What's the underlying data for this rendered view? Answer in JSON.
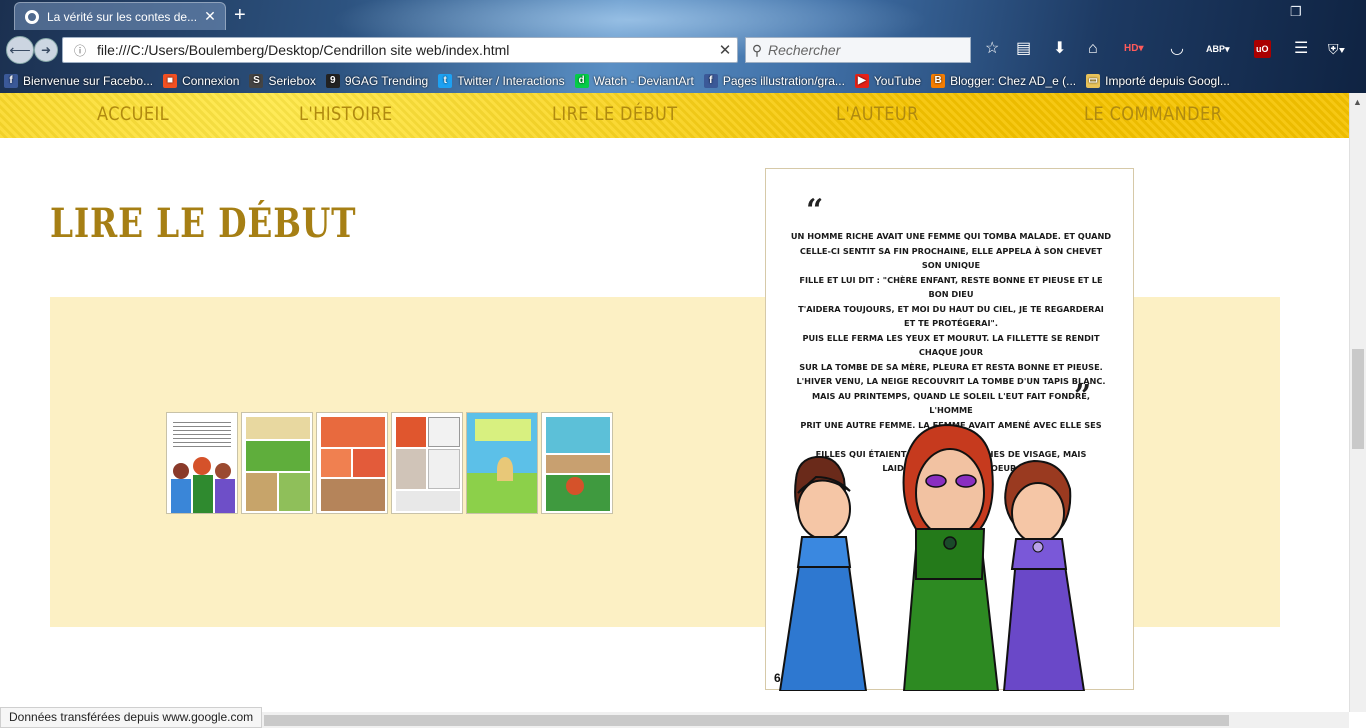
{
  "browser": {
    "tab_title": "La vérité sur les contes de...",
    "url": "file:///C:/Users/Boulemberg/Desktop/Cendrillon site web/index.html",
    "search_placeholder": "Rechercher",
    "bookmarks": [
      {
        "label": "Bienvenue sur Facebo...",
        "icon": "facebook-icon",
        "color": "#3b5998"
      },
      {
        "label": "Connexion",
        "icon": "windows-icon",
        "color": "#f25022"
      },
      {
        "label": "Seriebox",
        "icon": "seriebox-icon",
        "color": "#444444"
      },
      {
        "label": "9GAG Trending",
        "icon": "9gag-icon",
        "color": "#222222"
      },
      {
        "label": "Twitter / Interactions",
        "icon": "twitter-icon",
        "color": "#1da1f2"
      },
      {
        "label": "Watch - DeviantArt",
        "icon": "deviantart-icon",
        "color": "#05cc47"
      },
      {
        "label": "Pages illustration/gra...",
        "icon": "facebook-icon",
        "color": "#3b5998"
      },
      {
        "label": "YouTube",
        "icon": "youtube-icon",
        "color": "#e62117"
      },
      {
        "label": "Blogger: Chez AD_e (...",
        "icon": "blogger-icon",
        "color": "#f57d00"
      },
      {
        "label": "Importé depuis Googl...",
        "icon": "folder-icon",
        "color": "#e8c25a"
      }
    ],
    "status_text": "Données transférées depuis www.google.com"
  },
  "site_nav": [
    "ACCUEIL",
    "L'HISTOIRE",
    "LIRE LE DÉBUT",
    "L'AUTEUR",
    "LE COMMANDER"
  ],
  "page_title": "LIRE LE DÉBUT",
  "thumbnails_count": 6,
  "comic_page": {
    "text_lines": [
      "UN HOMME RICHE AVAIT UNE FEMME QUI TOMBA MALADE. ET QUAND",
      "CELLE-CI SENTIT SA FIN PROCHAINE, ELLE APPELA À SON CHEVET SON UNIQUE",
      "FILLE ET LUI  DIT : \"CHÈRE ENFANT, RESTE BONNE ET PIEUSE ET LE BON DIEU",
      "T'AIDERA TOUJOURS, ET MOI DU HAUT DU CIEL, JE TE REGARDERAI",
      "ET TE PROTÉGERAI\".",
      "PUIS ELLE FERMA LES YEUX ET MOURUT. LA FILLETTE SE RENDIT CHAQUE JOUR",
      "SUR LA TOMBE DE SA MÈRE, PLEURA ET RESTA BONNE ET PIEUSE.",
      "L'HIVER VENU, LA NEIGE RECOUVRIT LA TOMBE D'UN TAPIS BLANC.",
      "MAIS AU  PRINTEMPS, QUAND LE SOLEIL L'EUT FAIT FONDRE, L'HOMME",
      "PRIT UNE AUTRE FEMME. LA FEMME AVAIT AMENÉ AVEC ELLE SES DEUX",
      "FILLES QUI ÉTAIENT JOLIES ET BLANCHES DE VISAGE, MAIS",
      "LAIDES ET  NOIRES DE COEUR."
    ],
    "page_number": "6"
  }
}
